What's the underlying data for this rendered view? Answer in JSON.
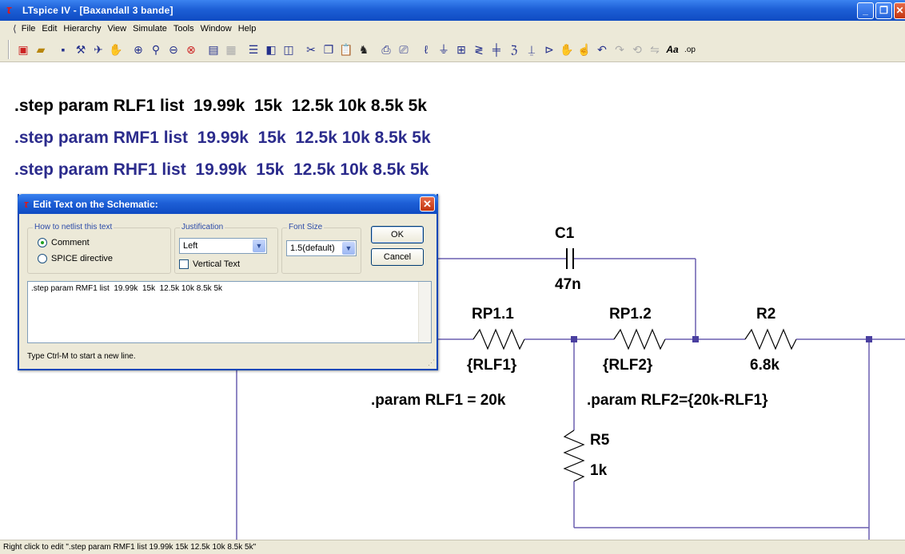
{
  "app": {
    "title": "LTspice IV - [Baxandall 3 bande]",
    "logo_glyph": "τ"
  },
  "menubar": {
    "items": [
      "File",
      "Edit",
      "Hierarchy",
      "View",
      "Simulate",
      "Tools",
      "Window",
      "Help"
    ]
  },
  "toolbar": {
    "icons": [
      "new-schematic",
      "open",
      "save",
      "control-panel",
      "run",
      "halt",
      "zoom-in",
      "pan",
      "zoom-out",
      "zoom-fit",
      "autorange",
      "grid",
      "tile-horizontal",
      "tile-vertical",
      "cascade",
      "cut",
      "copy",
      "paste",
      "find",
      "print-preview",
      "print",
      "draw-wire",
      "ground",
      "label-net",
      "resistor",
      "capacitor",
      "inductor",
      "diode",
      "component",
      "move",
      "drag",
      "undo",
      "redo",
      "rotate",
      "mirror",
      "text",
      "spice-directive"
    ]
  },
  "schematic": {
    "step_lines": [
      ".step param RLF1 list  19.99k  15k  12.5k 10k 8.5k 5k",
      ".step param RMF1 list  19.99k  15k  12.5k 10k 8.5k 5k",
      ".step param RHF1 list  19.99k  15k  12.5k 10k 8.5k 5k"
    ],
    "step_colors": [
      "#000000",
      "#2b2b8c",
      "#2b2b8c"
    ],
    "wire_color": "#6a5fb0",
    "node_color": "#4a3fa0",
    "components": {
      "c1_name": "C1",
      "c1_value": "47n",
      "rp11_name": "RP1.1",
      "rp11_value": "{RLF1}",
      "rp12_name": "RP1.2",
      "rp12_value": "{RLF2}",
      "r2_name": "R2",
      "r2_value": "6.8k",
      "r5_name": "R5",
      "r5_value": "1k"
    },
    "directives": {
      "param_rlf1": ".param RLF1 = 20k",
      "param_rlf2": ".param RLF2={20k-RLF1}"
    }
  },
  "dialog": {
    "title": "Edit Text on the Schematic:",
    "netlist_group": "How to netlist this text",
    "radio_comment": "Comment",
    "radio_spice": "SPICE directive",
    "justification_label": "Justification",
    "justification_value": "Left",
    "vertical_text": "Vertical Text",
    "font_size_label": "Font Size",
    "font_size_value": "1.5(default)",
    "ok": "OK",
    "cancel": "Cancel",
    "text_value": ".step param RMF1 list  19.99k  15k  12.5k 10k 8.5k 5k",
    "hint": "Type Ctrl-M to start a new line."
  },
  "status": {
    "text": "Right click to edit \".step param RMF1 list  19.99k  15k  12.5k 10k 8.5k 5k\""
  }
}
